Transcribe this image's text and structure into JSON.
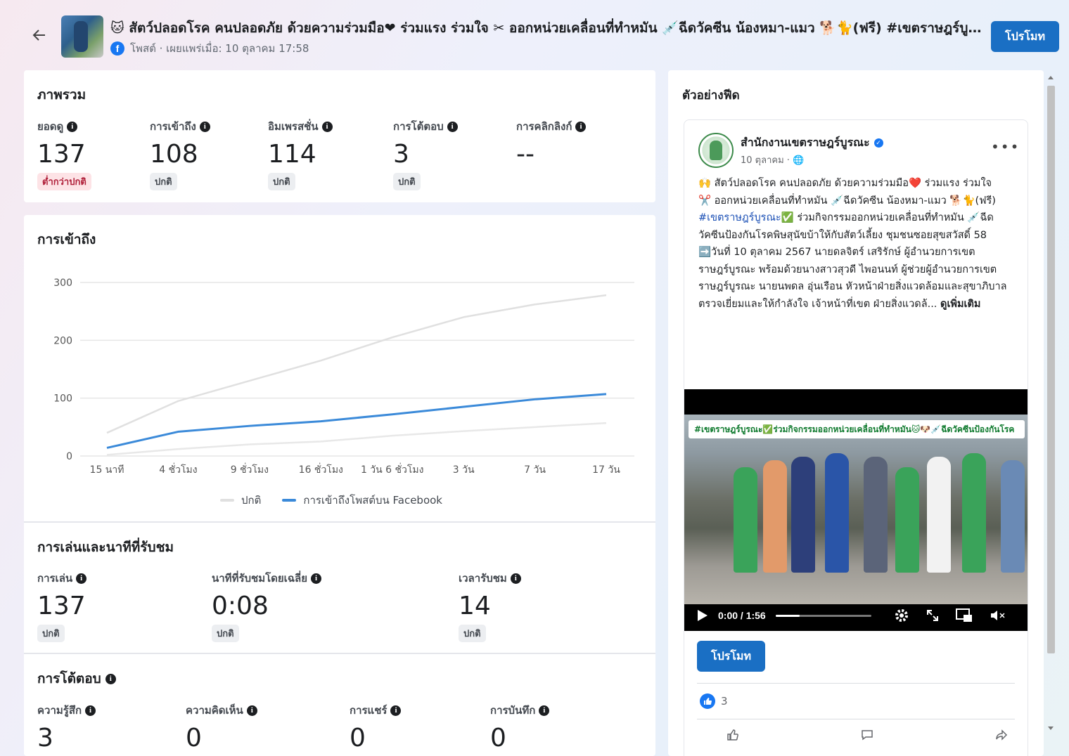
{
  "header": {
    "title": "🐱 สัตว์ปลอดโรค คนปลอดภัย ด้วยความร่วมมือ❤ ร่วมแรง ร่วมใจ ✂ ออกหน่วยเคลื่อนที่ทำหมัน 💉ฉีดวัคซีน น้องหมา-แมว 🐕🐈(ฟรี) #เขตราษฎร์บู...",
    "meta": "โพสต์ · เผยแพร่เมื่อ: 10 ตุลาคม 17:58",
    "promote_label": "โปรโมท"
  },
  "overview": {
    "title": "ภาพรวม",
    "metrics": [
      {
        "label": "ยอดดู",
        "value": "137",
        "badge": "ต่ำกว่าปกติ"
      },
      {
        "label": "การเข้าถึง",
        "value": "108",
        "badge": "ปกติ"
      },
      {
        "label": "อิมเพรสชั่น",
        "value": "114",
        "badge": "ปกติ"
      },
      {
        "label": "การโต้ตอบ",
        "value": "3",
        "badge": "ปกติ"
      },
      {
        "label": "การคลิกลิงก์",
        "value": "--",
        "badge": ""
      }
    ]
  },
  "reach": {
    "title": "การเข้าถึง",
    "legend": {
      "normal": "ปกติ",
      "post": "การเข้าถึงโพสต์บน Facebook"
    }
  },
  "chart_data": {
    "type": "line",
    "title": "การเข้าถึง",
    "categories": [
      "15 นาที",
      "4 ชั่วโมง",
      "9 ชั่วโมง",
      "16 ชั่วโมง",
      "1 วัน 6 ชั่วโมง",
      "3 วัน",
      "7 วัน",
      "17 วัน"
    ],
    "yticks": [
      0,
      100,
      200,
      300
    ],
    "ylim": [
      0,
      300
    ],
    "series": [
      {
        "name": "ปกติ",
        "color": "#e0e0e0",
        "values": [
          40,
          95,
          130,
          165,
          205,
          240,
          262,
          278
        ]
      },
      {
        "name": "การเข้าถึงโพสต์บน Facebook",
        "color": "#3b8ad9",
        "values": [
          14,
          42,
          52,
          60,
          72,
          85,
          98,
          107
        ]
      },
      {
        "name": "ปกติ (ขอบล่าง)",
        "color": "#e8e8e8",
        "values": [
          2,
          12,
          20,
          25,
          35,
          43,
          50,
          57
        ]
      }
    ],
    "legend": "bottom-center",
    "grid": true
  },
  "playback": {
    "title": "การเล่นและนาทีที่รับชม",
    "metrics": [
      {
        "label": "การเล่น",
        "value": "137",
        "badge": "ปกติ"
      },
      {
        "label": "นาทีที่รับชมโดยเฉลี่ย",
        "value": "0:08",
        "badge": "ปกติ"
      },
      {
        "label": "เวลารับชม",
        "value": "14",
        "badge": "ปกติ"
      }
    ]
  },
  "engagement": {
    "title": "การโต้ตอบ",
    "metrics": [
      {
        "label": "ความรู้สึก",
        "value": "3"
      },
      {
        "label": "ความคิดเห็น",
        "value": "0"
      },
      {
        "label": "การแชร์",
        "value": "0"
      },
      {
        "label": "การบันทึก",
        "value": "0"
      }
    ]
  },
  "feed": {
    "title": "ตัวอย่างฟีด",
    "page_name": "สำนักงานเขตราษฎร์บูรณะ",
    "date": "10 ตุลาคม ·",
    "line1": "🙌 สัตว์ปลอดโรค คนปลอดภัย ด้วยความร่วมมือ❤️ ร่วมแรง ร่วมใจ",
    "line2": "✂️ ออกหน่วยเคลื่อนที่ทำหมัน 💉ฉีดวัคซีน น้องหมา-แมว 🐕🐈(ฟรี)",
    "hashtag": "#เขตราษฎร์บูรณะ",
    "line3": "✅ ร่วมกิจกรรมออกหน่วยเคลื่อนที่ทำหมัน 💉ฉีดวัคซีนป้องกันโรคพิษสุนัขบ้าให้กับสัตว์เลี้ยง ชุมชนซอยสุขสวัสดิ์ 58",
    "line4": "➡️วันที่ 10 ตุลาคม 2567 นายดลจิตร์ เสริรักษ์ ผู้อำนวยการเขตราษฎร์บูรณะ พร้อมด้วยนางสาวสุวดี ไพอนนท์ ผู้ช่วยผู้อำนวยการเขตราษฎร์บูรณะ นายนพดล อุ่นเรือน หัวหน้าฝ่ายสิ่งแวดล้อมและสุขาภิบาล ตรวจเยี่ยมและให้กำลังใจ เจ้าหน้าที่เขต ฝ่ายสิ่งแวดล้... ",
    "see_more": "ดูเพิ่มเติม",
    "video_banner": "#เขตราษฎร์บูรณะ✅ร่วมกิจกรรมออกหน่วยเคลื่อนที่ทำหมัน🐱🐶💉ฉีดวัคซีนป้องกันโรค",
    "video_time": "0:00 / 1:56",
    "video_progress": 0.25,
    "promote_label": "โปรโมท",
    "reaction_count": "3"
  }
}
